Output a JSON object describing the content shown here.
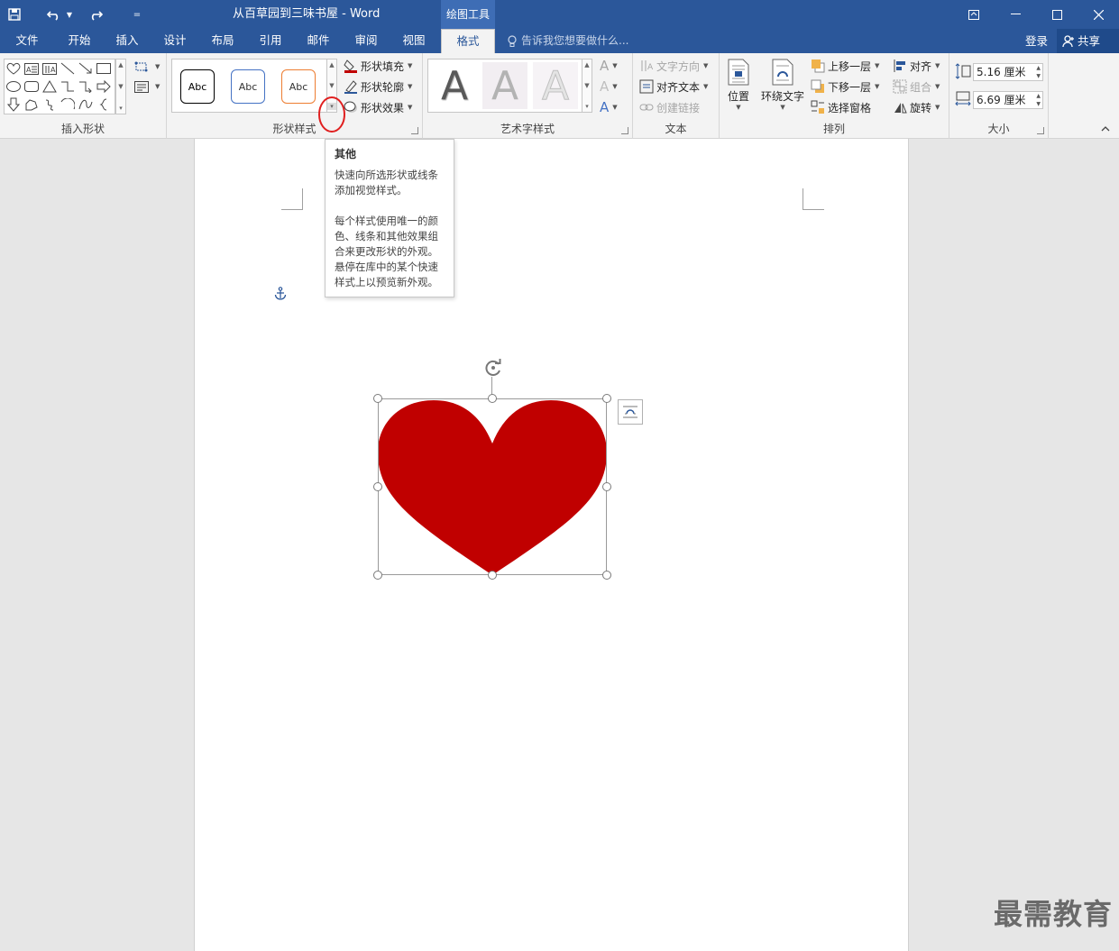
{
  "title_bar": {
    "document_title": "从百草园到三味书屋 - Word",
    "context_tab": "绘图工具"
  },
  "tabs": [
    "文件",
    "开始",
    "插入",
    "设计",
    "布局",
    "引用",
    "邮件",
    "审阅",
    "视图",
    "格式"
  ],
  "active_tab": "格式",
  "tell_me": "告诉我您想要做什么...",
  "account": {
    "signin": "登录",
    "share": "共享"
  },
  "ribbon": {
    "insert_shapes": {
      "label": "插入形状"
    },
    "shape_styles": {
      "label": "形状样式",
      "style_samples": [
        "Abc",
        "Abc",
        "Abc"
      ],
      "fill": "形状填充",
      "outline": "形状轮廓",
      "effects": "形状效果"
    },
    "wordart": {
      "label": "艺术字样式",
      "letters": [
        "A",
        "A",
        "A"
      ]
    },
    "text": {
      "label": "文本",
      "direction": "文字方向",
      "align": "对齐文本",
      "link": "创建链接"
    },
    "arrange": {
      "label": "排列",
      "position": "位置",
      "wrap": "环绕文字",
      "bring_forward": "上移一层",
      "send_backward": "下移一层",
      "selection_pane": "选择窗格",
      "align": "对齐",
      "group": "组合",
      "rotate": "旋转"
    },
    "size": {
      "label": "大小",
      "height": "5.16 厘米",
      "width": "6.69 厘米"
    }
  },
  "tooltip": {
    "title": "其他",
    "line1": "快速向所选形状或线条添加视觉样式。",
    "line2": "每个样式使用唯一的颜色、线条和其他效果组合来更改形状的外观。悬停在库中的某个快速样式上以预览新外观。"
  },
  "colors": {
    "accent": "#2b579a",
    "heart_fill": "#c00000",
    "highlight_circle": "#e02020"
  },
  "watermark": "最需教育"
}
